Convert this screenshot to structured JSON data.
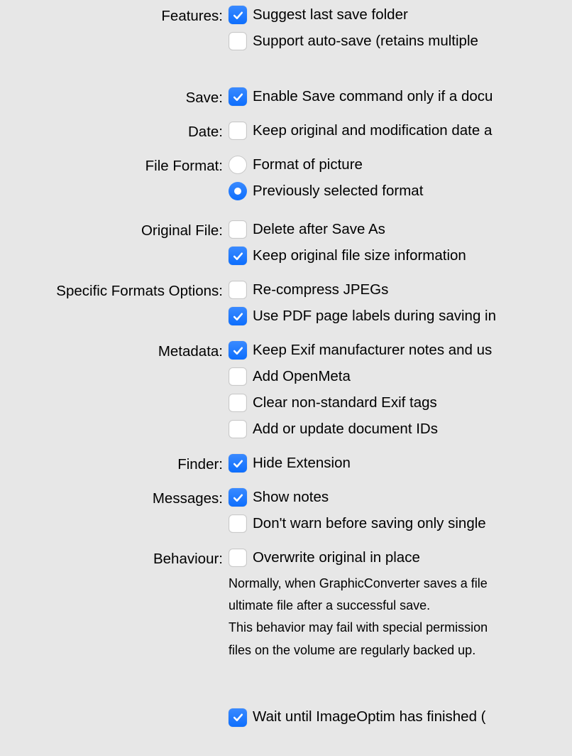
{
  "sections": {
    "features": {
      "label": "Features:",
      "items": [
        {
          "checked": true,
          "text": "Suggest last save folder",
          "name": "features-suggest-last-folder"
        },
        {
          "checked": false,
          "text": "Support auto-save (retains multiple ",
          "name": "features-auto-save"
        }
      ]
    },
    "save": {
      "label": "Save:",
      "items": [
        {
          "checked": true,
          "text": "Enable Save command only if a docu",
          "name": "save-enable-command"
        }
      ]
    },
    "date": {
      "label": "Date:",
      "items": [
        {
          "checked": false,
          "text": "Keep original and modification date a",
          "name": "date-keep-original"
        }
      ]
    },
    "fileformat": {
      "label": "File Format:",
      "type": "radio",
      "items": [
        {
          "checked": false,
          "text": "Format of picture",
          "name": "fileformat-picture"
        },
        {
          "checked": true,
          "text": "Previously selected format",
          "name": "fileformat-previous"
        }
      ]
    },
    "originalfile": {
      "label": "Original File:",
      "items": [
        {
          "checked": false,
          "text": "Delete after Save As",
          "name": "originalfile-delete"
        },
        {
          "checked": true,
          "text": "Keep original file size information",
          "name": "originalfile-keep-size"
        }
      ]
    },
    "specificformats": {
      "label": "Specific Formats Options:",
      "items": [
        {
          "checked": false,
          "text": "Re-compress JPEGs",
          "name": "specific-recompress-jpeg"
        },
        {
          "checked": true,
          "text": "Use PDF page labels during saving in",
          "name": "specific-pdf-labels"
        }
      ]
    },
    "metadata": {
      "label": "Metadata:",
      "items": [
        {
          "checked": true,
          "text": "Keep Exif manufacturer notes and us",
          "name": "metadata-keep-exif"
        },
        {
          "checked": false,
          "text": "Add OpenMeta",
          "name": "metadata-openmeta"
        },
        {
          "checked": false,
          "text": "Clear non-standard Exif tags",
          "name": "metadata-clear-exif"
        },
        {
          "checked": false,
          "text": "Add or update document IDs",
          "name": "metadata-document-ids"
        }
      ]
    },
    "finder": {
      "label": "Finder:",
      "items": [
        {
          "checked": true,
          "text": "Hide Extension",
          "name": "finder-hide-extension"
        }
      ]
    },
    "messages": {
      "label": "Messages:",
      "items": [
        {
          "checked": true,
          "text": "Show notes",
          "name": "messages-show-notes"
        },
        {
          "checked": false,
          "text": "Don't warn before saving only single",
          "name": "messages-dont-warn"
        }
      ]
    },
    "behaviour": {
      "label": "Behaviour:",
      "items": [
        {
          "checked": false,
          "text": "Overwrite original in place",
          "name": "behaviour-overwrite"
        }
      ],
      "note1": "Normally, when GraphicConverter saves a file",
      "note2": "ultimate file after a successful save.",
      "note3": "This behavior may fail with special permission",
      "note4": "files on the volume are regularly backed up."
    },
    "imageoptim": {
      "items": [
        {
          "checked": true,
          "text": "Wait until ImageOptim has finished (",
          "name": "imageoptim-wait"
        }
      ]
    }
  }
}
